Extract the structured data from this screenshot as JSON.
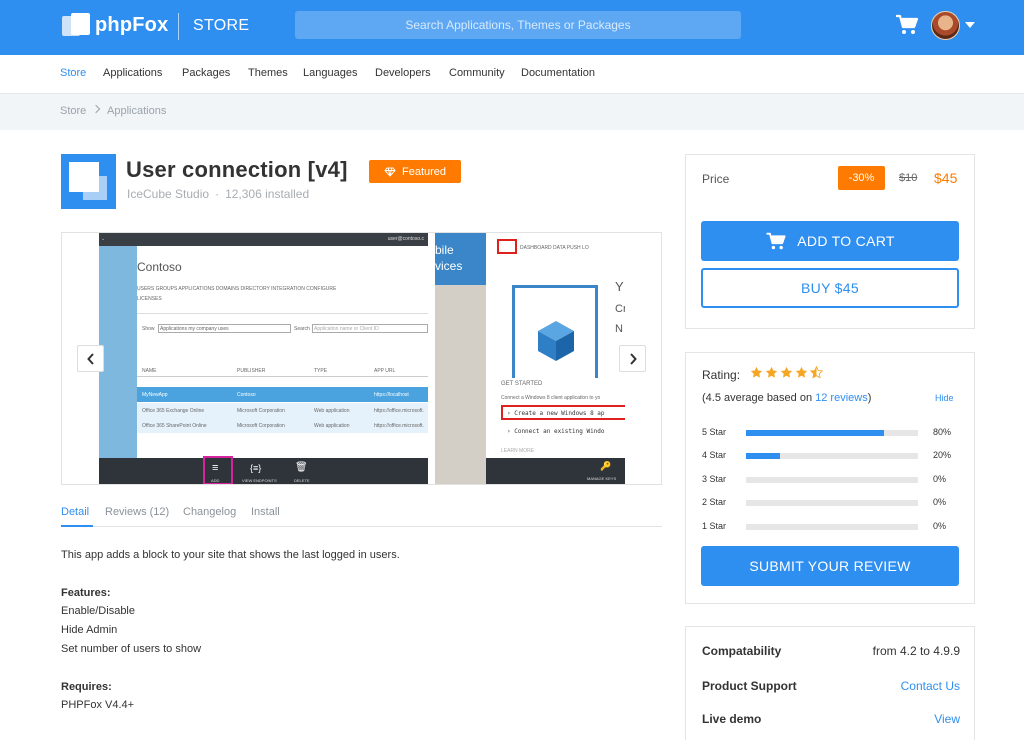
{
  "header": {
    "logo_text": "phpFox",
    "section": "STORE",
    "search_placeholder": "Search Applications, Themes or Packages"
  },
  "nav": {
    "items": [
      "Store",
      "Applications",
      "Packages",
      "Themes",
      "Languages",
      "Developers",
      "Community",
      "Documentation"
    ],
    "active": "Store"
  },
  "breadcrumb": [
    "Store",
    "Applications"
  ],
  "app": {
    "title": "User connection [v4]",
    "featured_label": "Featured",
    "author": "IceCube Studio",
    "separator": "·",
    "installs": "12,306 installed"
  },
  "screenshots": {
    "shot1": {
      "org": "Contoso",
      "user": "user@contoso.c",
      "tabs": "USERS   GROUPS   APPLICATIONS   DOMAINS   DIRECTORY INTEGRATION   CONFIGURE",
      "tabs2": "LICENSES",
      "show_label": "Show",
      "show_value": "Applications my company uses",
      "search_label": "Search",
      "search_placeholder": "Application name or Client ID",
      "columns": [
        "NAME",
        "PUBLISHER",
        "TYPE",
        "APP URL"
      ],
      "rows": [
        [
          "MyNewApp",
          "Contoso",
          "Web application",
          "https://localhost"
        ],
        [
          "Office 365 Exchange Online",
          "Microsoft Corporation",
          "Web application",
          "https://office.microsoft."
        ],
        [
          "Office 365 SharePoint Online",
          "Microsoft Corporation",
          "Web application",
          "https://office.microsoft."
        ]
      ],
      "actions": [
        "ADD",
        "VIEW ENDPOINTS",
        "DELETE"
      ]
    },
    "shot2": {
      "side_text": [
        "bile",
        "vices"
      ],
      "tabs": "DASHBOARD   DATA   PUSH   LO",
      "get_started": "GET STARTED",
      "connect_text": "Connect a Windows 8 client application to yo",
      "option1": "› Create a new Windows 8 ap",
      "option2": "› Connect an existing Windo",
      "learn_more": "LEARN MORE",
      "manage_keys": "MANAGE KEYS",
      "side_letters": [
        "Y",
        "Cr",
        "N"
      ]
    }
  },
  "tabs": {
    "items": [
      "Detail",
      "Reviews (12)",
      "Changelog",
      "Install"
    ],
    "active": "Detail"
  },
  "description": {
    "intro": "This app adds a block to your site that shows the last logged in users.",
    "features_title": "Features:",
    "features": [
      "Enable/Disable",
      "Hide Admin",
      "Set number of users to show"
    ],
    "requires_title": "Requires:",
    "requires": "PHPFox V4.4+"
  },
  "pricing": {
    "label": "Price",
    "discount": "-30%",
    "old_price": "$10",
    "new_price": "$45",
    "add_to_cart": "ADD TO CART",
    "buy": "BUY $45"
  },
  "rating": {
    "label": "Rating:",
    "stars": 4.5,
    "avg_prefix": "(4.5 average based on ",
    "avg_link": "12 reviews",
    "avg_suffix": ")",
    "hide": "Hide",
    "bars": [
      {
        "label": "5 Star",
        "pct": "80%",
        "value": 0.8
      },
      {
        "label": "4 Star",
        "pct": "20%",
        "value": 0.2
      },
      {
        "label": "3 Star",
        "pct": "0%",
        "value": 0
      },
      {
        "label": "2 Star",
        "pct": "0%",
        "value": 0
      },
      {
        "label": "1 Star",
        "pct": "0%",
        "value": 0
      }
    ],
    "submit": "SUBMIT YOUR REVIEW"
  },
  "info": {
    "compat_label": "Compatability",
    "compat_value": "from 4.2 to 4.9.9",
    "support_label": "Product Support",
    "support_value": "Contact Us",
    "demo_label": "Live demo",
    "demo_value": "View"
  },
  "colors": {
    "primary": "#2f8ff0",
    "accent": "#ff7a00",
    "star": "#f5a623"
  }
}
